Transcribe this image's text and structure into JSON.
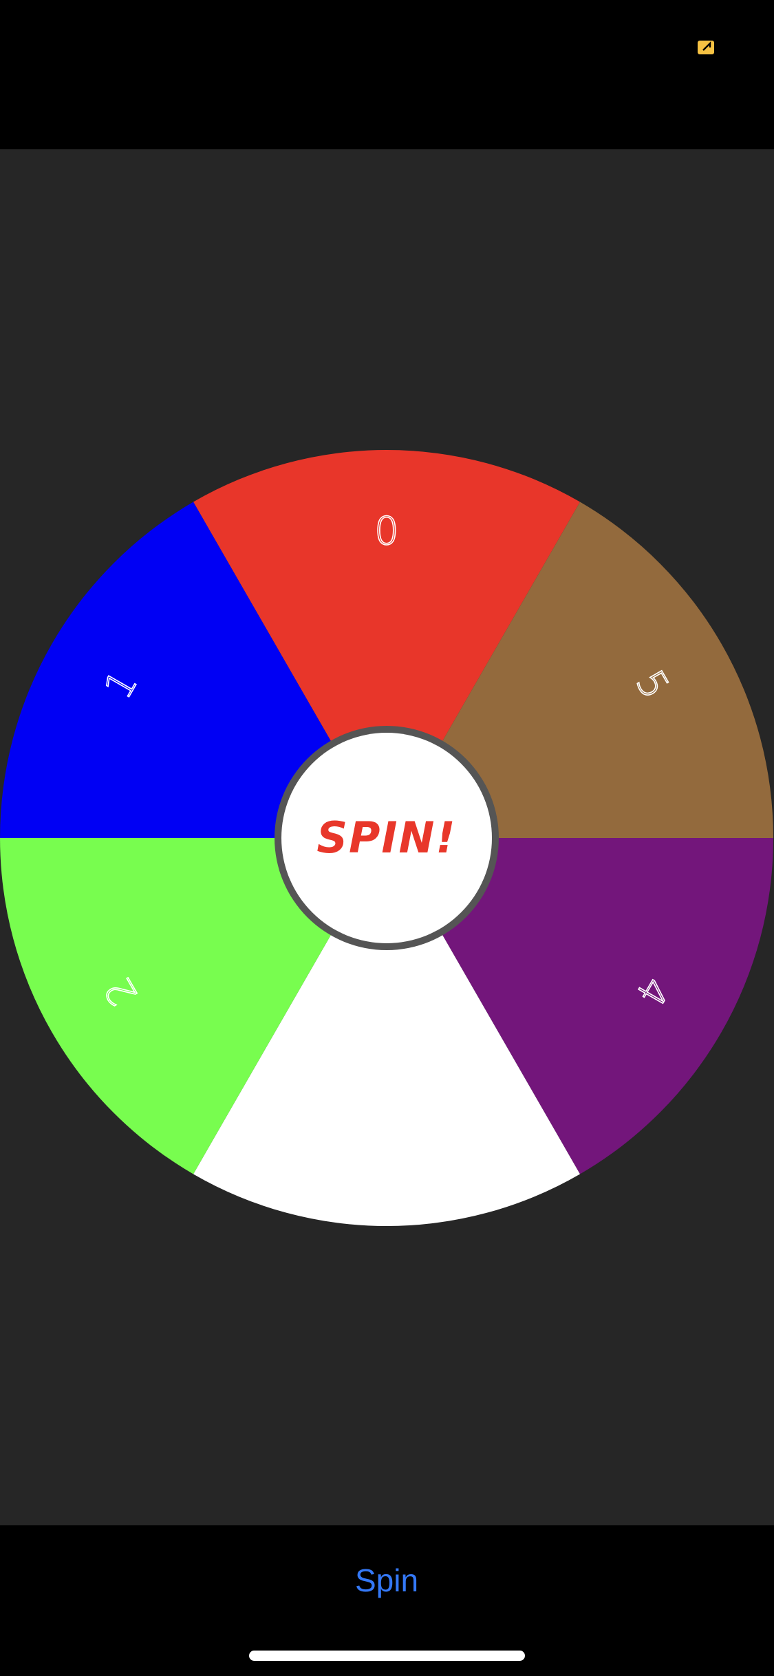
{
  "status_bar": {
    "indicator_icon": "orange-location-indicator-icon",
    "indicator_color": "#f6c243"
  },
  "wheel": {
    "segments": [
      {
        "label": "0",
        "color": "#e8362a",
        "label_rotation_deg": 0
      },
      {
        "label": "5",
        "color": "#936a3d",
        "label_rotation_deg": 60
      },
      {
        "label": "4",
        "color": "#73167b",
        "label_rotation_deg": 120
      },
      {
        "label": "",
        "color": "#ffffff",
        "label_rotation_deg": 180
      },
      {
        "label": "2",
        "color": "#78fd4f",
        "label_rotation_deg": 240
      },
      {
        "label": "1",
        "color": "#0000f4",
        "label_rotation_deg": 300
      }
    ],
    "center_button": {
      "label": "SPIN!",
      "text_color": "#e8372a",
      "ring_color": "#555555",
      "fill_color": "#ffffff"
    }
  },
  "toolbar": {
    "spin_label": "Spin",
    "accent_color": "#3478f6"
  },
  "colors": {
    "background": "#262626",
    "bars": "#000000"
  }
}
